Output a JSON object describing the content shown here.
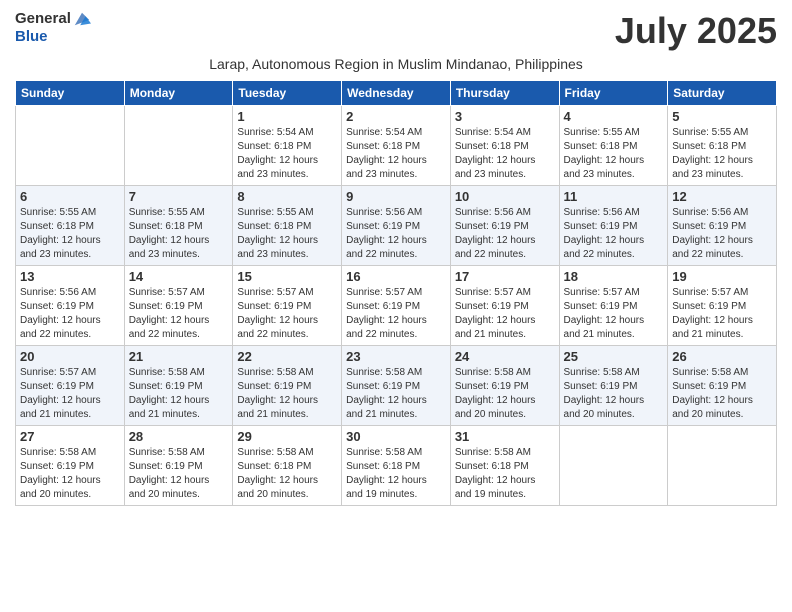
{
  "logo": {
    "general": "General",
    "blue": "Blue"
  },
  "header": {
    "month_year": "July 2025",
    "subtitle": "Larap, Autonomous Region in Muslim Mindanao, Philippines"
  },
  "days_of_week": [
    "Sunday",
    "Monday",
    "Tuesday",
    "Wednesday",
    "Thursday",
    "Friday",
    "Saturday"
  ],
  "weeks": [
    {
      "shade": "white",
      "days": [
        {
          "num": "",
          "info": ""
        },
        {
          "num": "",
          "info": ""
        },
        {
          "num": "1",
          "info": "Sunrise: 5:54 AM\nSunset: 6:18 PM\nDaylight: 12 hours and 23 minutes."
        },
        {
          "num": "2",
          "info": "Sunrise: 5:54 AM\nSunset: 6:18 PM\nDaylight: 12 hours and 23 minutes."
        },
        {
          "num": "3",
          "info": "Sunrise: 5:54 AM\nSunset: 6:18 PM\nDaylight: 12 hours and 23 minutes."
        },
        {
          "num": "4",
          "info": "Sunrise: 5:55 AM\nSunset: 6:18 PM\nDaylight: 12 hours and 23 minutes."
        },
        {
          "num": "5",
          "info": "Sunrise: 5:55 AM\nSunset: 6:18 PM\nDaylight: 12 hours and 23 minutes."
        }
      ]
    },
    {
      "shade": "shaded",
      "days": [
        {
          "num": "6",
          "info": "Sunrise: 5:55 AM\nSunset: 6:18 PM\nDaylight: 12 hours and 23 minutes."
        },
        {
          "num": "7",
          "info": "Sunrise: 5:55 AM\nSunset: 6:18 PM\nDaylight: 12 hours and 23 minutes."
        },
        {
          "num": "8",
          "info": "Sunrise: 5:55 AM\nSunset: 6:18 PM\nDaylight: 12 hours and 23 minutes."
        },
        {
          "num": "9",
          "info": "Sunrise: 5:56 AM\nSunset: 6:19 PM\nDaylight: 12 hours and 22 minutes."
        },
        {
          "num": "10",
          "info": "Sunrise: 5:56 AM\nSunset: 6:19 PM\nDaylight: 12 hours and 22 minutes."
        },
        {
          "num": "11",
          "info": "Sunrise: 5:56 AM\nSunset: 6:19 PM\nDaylight: 12 hours and 22 minutes."
        },
        {
          "num": "12",
          "info": "Sunrise: 5:56 AM\nSunset: 6:19 PM\nDaylight: 12 hours and 22 minutes."
        }
      ]
    },
    {
      "shade": "white",
      "days": [
        {
          "num": "13",
          "info": "Sunrise: 5:56 AM\nSunset: 6:19 PM\nDaylight: 12 hours and 22 minutes."
        },
        {
          "num": "14",
          "info": "Sunrise: 5:57 AM\nSunset: 6:19 PM\nDaylight: 12 hours and 22 minutes."
        },
        {
          "num": "15",
          "info": "Sunrise: 5:57 AM\nSunset: 6:19 PM\nDaylight: 12 hours and 22 minutes."
        },
        {
          "num": "16",
          "info": "Sunrise: 5:57 AM\nSunset: 6:19 PM\nDaylight: 12 hours and 22 minutes."
        },
        {
          "num": "17",
          "info": "Sunrise: 5:57 AM\nSunset: 6:19 PM\nDaylight: 12 hours and 21 minutes."
        },
        {
          "num": "18",
          "info": "Sunrise: 5:57 AM\nSunset: 6:19 PM\nDaylight: 12 hours and 21 minutes."
        },
        {
          "num": "19",
          "info": "Sunrise: 5:57 AM\nSunset: 6:19 PM\nDaylight: 12 hours and 21 minutes."
        }
      ]
    },
    {
      "shade": "shaded",
      "days": [
        {
          "num": "20",
          "info": "Sunrise: 5:57 AM\nSunset: 6:19 PM\nDaylight: 12 hours and 21 minutes."
        },
        {
          "num": "21",
          "info": "Sunrise: 5:58 AM\nSunset: 6:19 PM\nDaylight: 12 hours and 21 minutes."
        },
        {
          "num": "22",
          "info": "Sunrise: 5:58 AM\nSunset: 6:19 PM\nDaylight: 12 hours and 21 minutes."
        },
        {
          "num": "23",
          "info": "Sunrise: 5:58 AM\nSunset: 6:19 PM\nDaylight: 12 hours and 21 minutes."
        },
        {
          "num": "24",
          "info": "Sunrise: 5:58 AM\nSunset: 6:19 PM\nDaylight: 12 hours and 20 minutes."
        },
        {
          "num": "25",
          "info": "Sunrise: 5:58 AM\nSunset: 6:19 PM\nDaylight: 12 hours and 20 minutes."
        },
        {
          "num": "26",
          "info": "Sunrise: 5:58 AM\nSunset: 6:19 PM\nDaylight: 12 hours and 20 minutes."
        }
      ]
    },
    {
      "shade": "white",
      "days": [
        {
          "num": "27",
          "info": "Sunrise: 5:58 AM\nSunset: 6:19 PM\nDaylight: 12 hours and 20 minutes."
        },
        {
          "num": "28",
          "info": "Sunrise: 5:58 AM\nSunset: 6:19 PM\nDaylight: 12 hours and 20 minutes."
        },
        {
          "num": "29",
          "info": "Sunrise: 5:58 AM\nSunset: 6:18 PM\nDaylight: 12 hours and 20 minutes."
        },
        {
          "num": "30",
          "info": "Sunrise: 5:58 AM\nSunset: 6:18 PM\nDaylight: 12 hours and 19 minutes."
        },
        {
          "num": "31",
          "info": "Sunrise: 5:58 AM\nSunset: 6:18 PM\nDaylight: 12 hours and 19 minutes."
        },
        {
          "num": "",
          "info": ""
        },
        {
          "num": "",
          "info": ""
        }
      ]
    }
  ]
}
